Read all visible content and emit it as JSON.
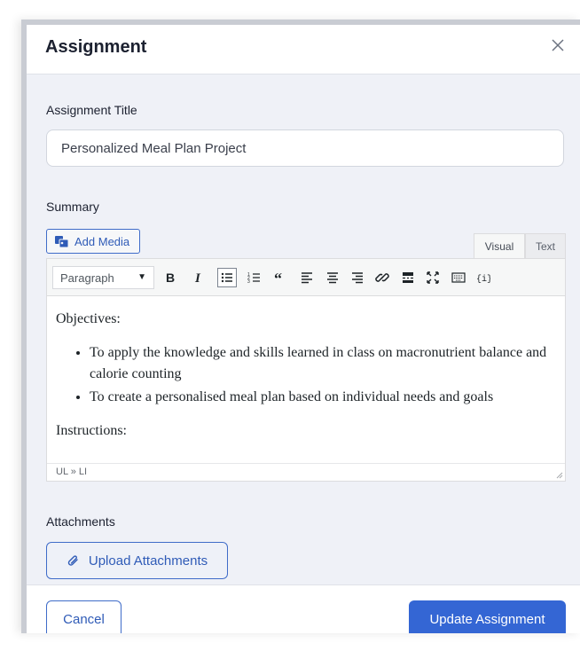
{
  "modal": {
    "title": "Assignment"
  },
  "assignment_title": {
    "label": "Assignment Title",
    "value": "Personalized Meal Plan Project"
  },
  "summary": {
    "label": "Summary",
    "add_media_label": "Add Media",
    "tabs": [
      {
        "label": "Visual",
        "active": true
      },
      {
        "label": "Text",
        "active": false
      }
    ],
    "format_select": "Paragraph",
    "toolbar_icons": [
      "bold-icon",
      "italic-icon",
      "bullet-list-icon",
      "numbered-list-icon",
      "blockquote-icon",
      "align-left-icon",
      "align-center-icon",
      "align-right-icon",
      "link-icon",
      "read-more-icon",
      "fullscreen-icon",
      "keyboard-icon",
      "shortcode-icon"
    ],
    "content": {
      "heading1": "Objectives:",
      "bullets": [
        "To apply the knowledge and skills learned in class on macronutrient balance and calorie counting",
        "To create a personalised meal plan based on individual needs and goals"
      ],
      "heading2": "Instructions:"
    },
    "path": "UL » LI"
  },
  "attachments": {
    "label": "Attachments",
    "upload_label": "Upload Attachments"
  },
  "footer": {
    "cancel_label": "Cancel",
    "update_label": "Update Assignment"
  },
  "colors": {
    "accent": "#3466d4",
    "background": "#eff1f7"
  }
}
